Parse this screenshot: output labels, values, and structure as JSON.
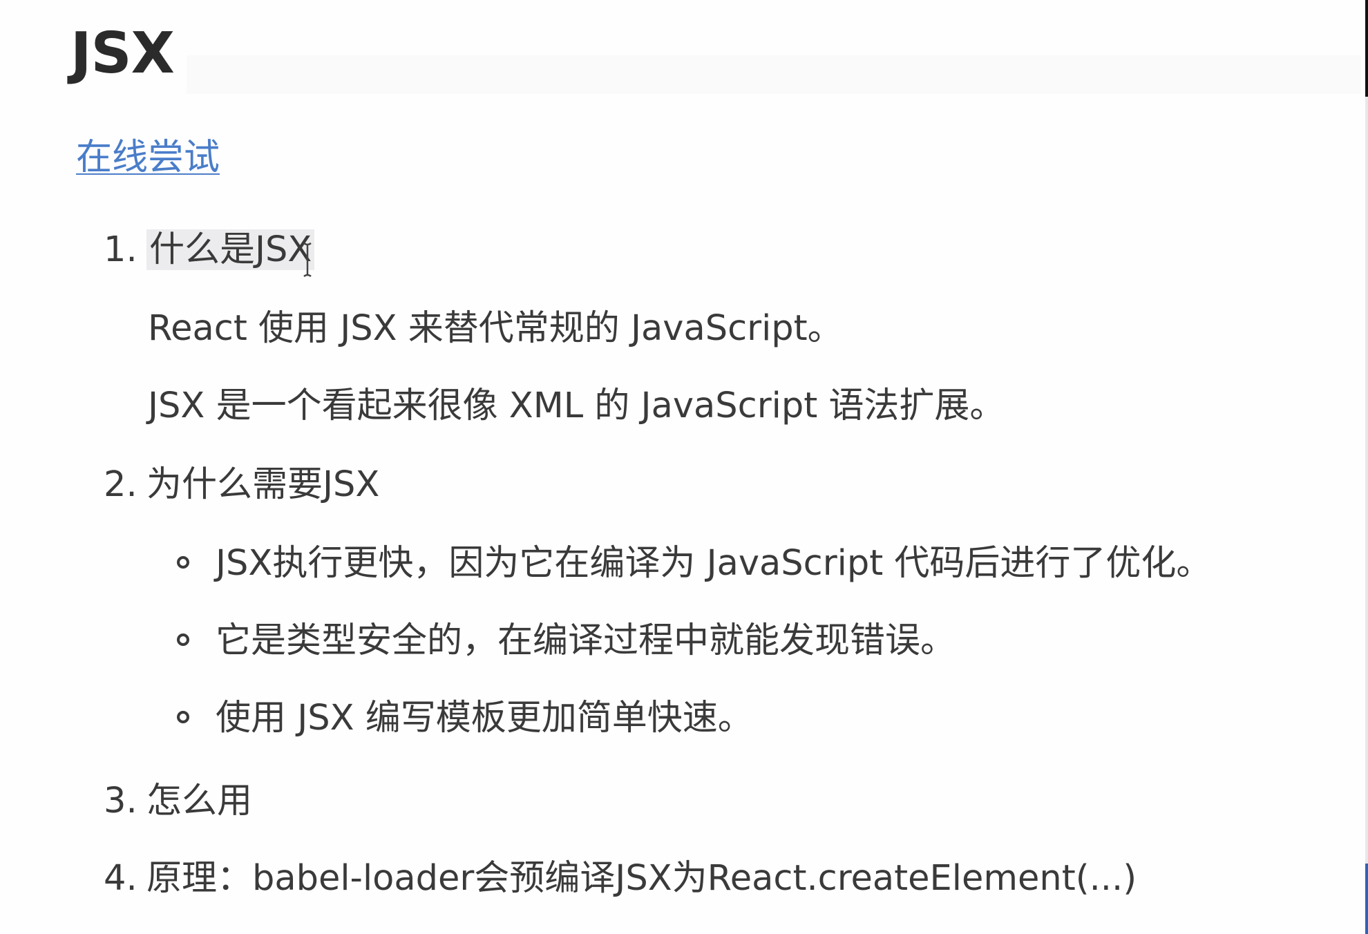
{
  "title": "JSX",
  "try_link": "在线尝试",
  "items": [
    {
      "number": "1.",
      "heading": "什么是JSX",
      "paragraphs": [
        "React 使用 JSX 来替代常规的 JavaScript。",
        "JSX 是一个看起来很像 XML 的 JavaScript 语法扩展。"
      ]
    },
    {
      "number": "2.",
      "heading": "为什么需要JSX",
      "bullets": [
        "JSX执行更快，因为它在编译为 JavaScript 代码后进行了优化。",
        "它是类型安全的，在编译过程中就能发现错误。",
        "使用 JSX 编写模板更加简单快速。"
      ]
    },
    {
      "number": "3.",
      "heading": "怎么用"
    },
    {
      "number": "4.",
      "heading": "原理：babel-loader会预编译JSX为React.createElement(...)"
    }
  ],
  "icons": {
    "cursor": "text-cursor-icon",
    "bullet": "hollow-circle-bullet-icon"
  }
}
